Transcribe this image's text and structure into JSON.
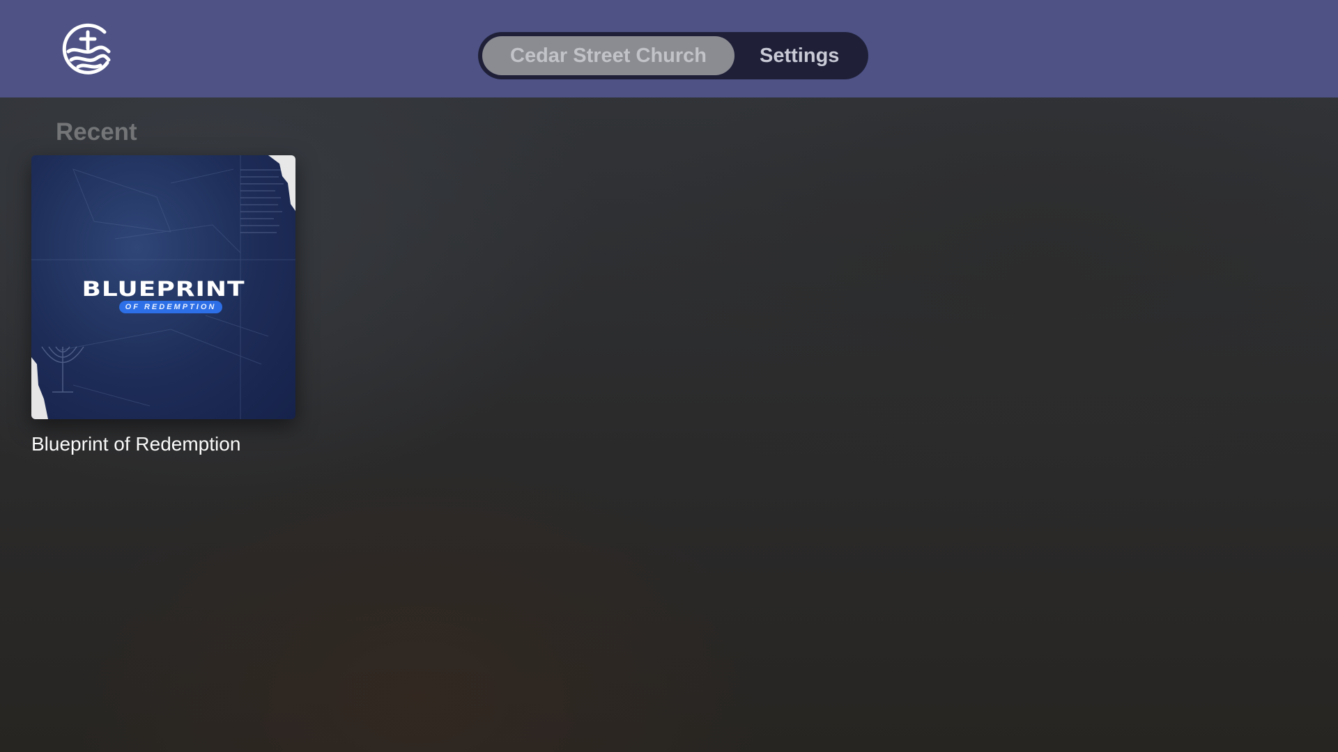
{
  "header": {
    "logo_icon": "church-cross-waves-logo",
    "tabs": [
      {
        "label": "Cedar Street Church",
        "selected": true
      },
      {
        "label": "Settings",
        "selected": false
      }
    ]
  },
  "recent": {
    "title": "Recent",
    "items": [
      {
        "title": "Blueprint of Redemption",
        "artwork": {
          "headline": "BLUEPRINT",
          "subtitle": "OF REDEMPTION"
        }
      }
    ]
  },
  "colors": {
    "header_bg": "#4e5285",
    "tab_bar_bg": "#1f2038",
    "selected_tab_bg": "#8b8c92",
    "accent_blue": "#2d6fe6"
  }
}
